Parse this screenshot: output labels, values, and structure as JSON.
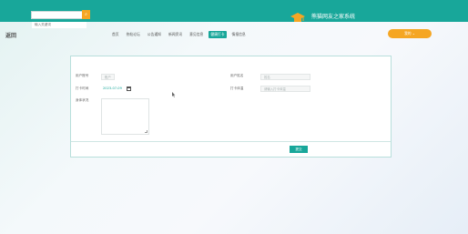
{
  "header": {
    "search_placeholder": "输入关键词",
    "search_icon": "search-icon",
    "brand_title": "熊猫网友之家系统"
  },
  "nav": {
    "logo": "返回",
    "items": [
      {
        "label": "首页",
        "active": false
      },
      {
        "label": "热帖论坛",
        "active": false
      },
      {
        "label": "公告通知",
        "active": false
      },
      {
        "label": "新闻资讯",
        "active": false
      },
      {
        "label": "意见信息",
        "active": false
      },
      {
        "label": "健康打卡",
        "active": true
      },
      {
        "label": "情报信息",
        "active": false
      }
    ],
    "mine_button": "我的 ⌄"
  },
  "form": {
    "field1_label": "用户账号",
    "field1_value": "账户",
    "field2_label": "用户姓名",
    "field2_value": "姓名",
    "date_label": "打卡时间",
    "date_value": "2023-07-09",
    "temp_label": "打卡体温",
    "temp_placeholder": "请输入打卡体温",
    "notes_label": "身体状况",
    "submit_label": "提交"
  },
  "colors": {
    "primary": "#18a79a",
    "accent": "#f5a623"
  }
}
